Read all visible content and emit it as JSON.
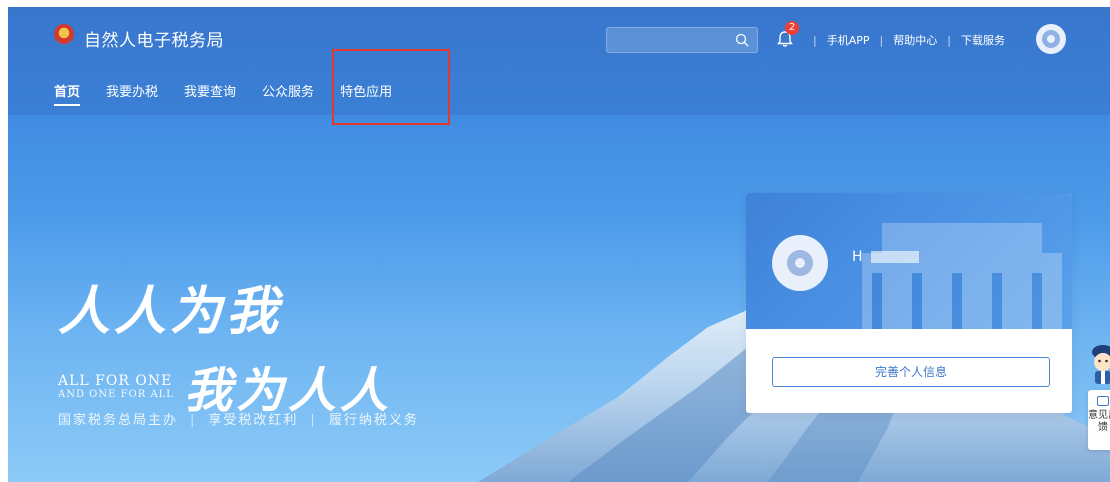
{
  "header": {
    "brand_name": "自然人电子税务局",
    "search": {
      "placeholder": "",
      "value": ""
    },
    "notification_count": "2",
    "links": [
      "手机APP",
      "帮助中心",
      "下载服务"
    ],
    "separator": "|"
  },
  "nav": {
    "items": [
      {
        "label": "首页",
        "active": true
      },
      {
        "label": "我要办税",
        "active": false
      },
      {
        "label": "我要查询",
        "active": false
      },
      {
        "label": "公众服务",
        "active": false
      },
      {
        "label": "特色应用",
        "active": false
      }
    ]
  },
  "hero": {
    "slogan_line1": "人人为我",
    "slogan_en_line1": "ALL FOR ONE",
    "slogan_en_line2": "AND ONE FOR ALL",
    "slogan_line2": "我为人人",
    "tagline": [
      "国家税务总局主办",
      "享受税改红利",
      "履行纳税义务"
    ]
  },
  "user_card": {
    "name": "H",
    "button_label": "完善个人信息"
  },
  "feedback": {
    "label": "意见反馈"
  },
  "colors": {
    "accent": "#3b78c9",
    "highlight": "#e03a2f",
    "badge": "#ee3e36"
  }
}
